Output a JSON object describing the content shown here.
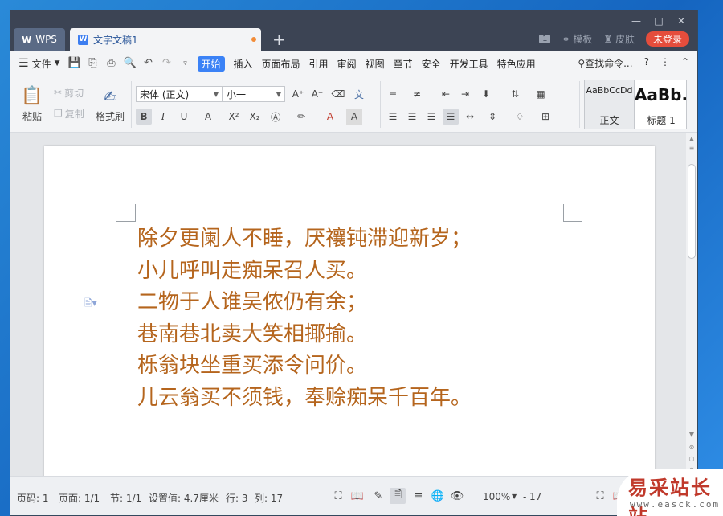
{
  "titlebar": {
    "app_tab": "WPS",
    "doc_tab": "文字文稿1",
    "new_tab": "+",
    "page_badge": "1",
    "template": "模板",
    "skin": "皮肤",
    "login": "未登录"
  },
  "menu": {
    "file": "文件",
    "tabs": [
      "开始",
      "插入",
      "页面布局",
      "引用",
      "审阅",
      "视图",
      "章节",
      "安全",
      "开发工具",
      "特色应用"
    ],
    "active_tab": "开始",
    "search": "查找命令...",
    "help": "?"
  },
  "ribbon": {
    "paste": "粘贴",
    "cut": "剪切",
    "copy": "复制",
    "format_painter": "格式刷",
    "font_name": "宋体 (正文)",
    "font_size": "小一",
    "styles": [
      {
        "preview": "AaBbCcDd",
        "name": "正文"
      },
      {
        "preview": "AaBb.",
        "name": "标题 1"
      }
    ]
  },
  "document": {
    "lines": [
      "除夕更阑人不睡，厌禳钝滞迎新岁；",
      "小儿呼叫走痴呆召人买。",
      "二物于人谁吴侬仍有余；",
      "巷南巷北卖大笑相揶揄。",
      "栎翁块坐重买添令问价。",
      "儿云翁买不须钱，奉赊痴呆千百年。"
    ],
    "text_color": "#b5651d"
  },
  "status": {
    "page_code": "页码: 1",
    "page": "页面: 1/1",
    "section": "节: 1/1",
    "setting": "设置值: 4.7厘米",
    "row": "行: 3",
    "col": "列: 17",
    "zoom": "100%",
    "zoom_minus": "-",
    "zoom_value": "17"
  },
  "watermark": {
    "main": "易采站长站",
    "sub": "www.easck.com"
  }
}
